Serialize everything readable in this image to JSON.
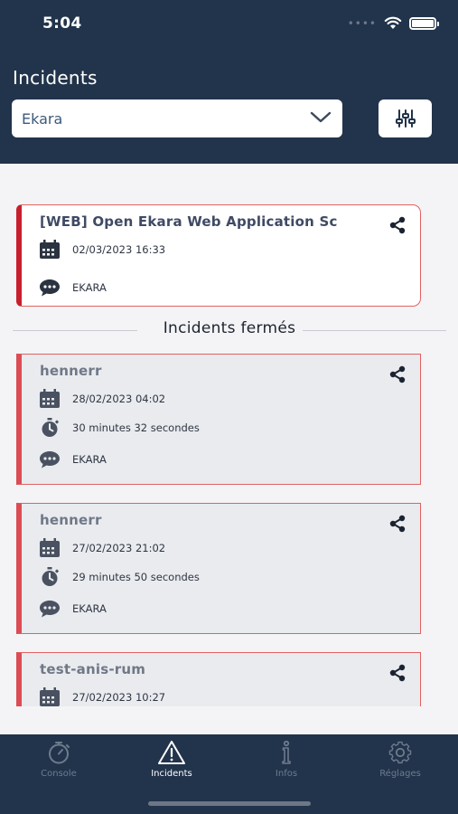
{
  "status_bar": {
    "time": "5:04"
  },
  "header": {
    "title": "Incidents",
    "select_value": "Ekara"
  },
  "open_incidents": [
    {
      "title": "[WEB] Open Ekara Web Application Sc",
      "date": "02/03/2023 16:33",
      "comment": "EKARA"
    }
  ],
  "closed_section_title": "Incidents fermés",
  "closed_incidents": [
    {
      "title": "hennerr",
      "date": "28/02/2023 04:02",
      "duration": "30 minutes 32 secondes",
      "comment": "EKARA"
    },
    {
      "title": "hennerr",
      "date": "27/02/2023 21:02",
      "duration": "29 minutes 50 secondes",
      "comment": "EKARA"
    },
    {
      "title": "test-anis-rum",
      "date": "27/02/2023 10:27"
    }
  ],
  "tabs": [
    {
      "label": "Console",
      "icon": "stopwatch-icon",
      "active": false
    },
    {
      "label": "Incidents",
      "icon": "warning-icon",
      "active": true
    },
    {
      "label": "Infos",
      "icon": "info-icon",
      "active": false
    },
    {
      "label": "Réglages",
      "icon": "gear-icon",
      "active": false
    }
  ],
  "colors": {
    "header_bg": "#22344b",
    "open_accent": "#c81f2e",
    "card_border": "#e26161",
    "closed_card_bg": "#e9ebee"
  }
}
